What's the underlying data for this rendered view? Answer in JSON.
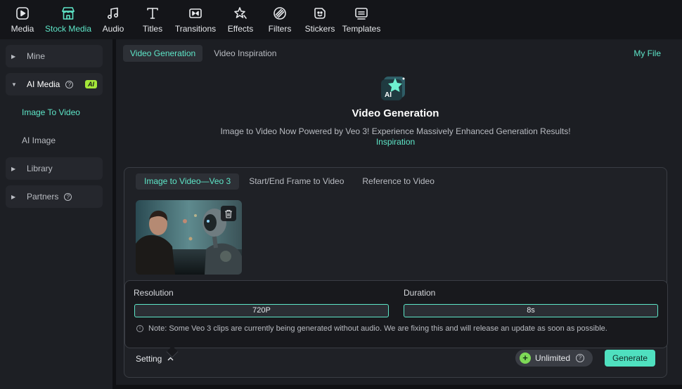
{
  "toolbar": {
    "items": [
      {
        "label": "Media",
        "icon": "media-icon"
      },
      {
        "label": "Stock Media",
        "icon": "store-icon"
      },
      {
        "label": "Audio",
        "icon": "music-icon"
      },
      {
        "label": "Titles",
        "icon": "text-icon"
      },
      {
        "label": "Transitions",
        "icon": "transitions-icon"
      },
      {
        "label": "Effects",
        "icon": "effects-icon"
      },
      {
        "label": "Filters",
        "icon": "filters-icon"
      },
      {
        "label": "Stickers",
        "icon": "stickers-icon"
      },
      {
        "label": "Templates",
        "icon": "templates-icon"
      }
    ],
    "active": "Stock Media"
  },
  "sidebar": {
    "mine": "Mine",
    "ai_media": "AI Media",
    "ai_badge": "AI",
    "image_to_video": "Image To Video",
    "ai_image": "AI Image",
    "library": "Library",
    "partners": "Partners"
  },
  "main": {
    "tabs": [
      "Video Generation",
      "Video Inspiration"
    ],
    "my_file": "My File",
    "title": "Video Generation",
    "subtitle": "Image to Video Now Powered by Veo 3! Experience Massively Enhanced Generation Results!",
    "inspiration_link": "Inspiration",
    "mode_tabs": [
      "Image to Video—Veo 3",
      "Start/End Frame to Video",
      "Reference to Video"
    ],
    "resolution_label": "Resolution",
    "resolution_value": "720P",
    "duration_label": "Duration",
    "duration_value": "8s",
    "note": "Note: Some Veo 3 clips are currently being generated without audio. We are fixing this and will release an update as soon as possible.",
    "setting_label": "Setting",
    "unlimited_label": "Unlimited",
    "generate_label": "Generate"
  },
  "colors": {
    "accent": "#5ee6c8",
    "generate_button": "#4fe0bf",
    "ai_badge": "#a4e639"
  }
}
